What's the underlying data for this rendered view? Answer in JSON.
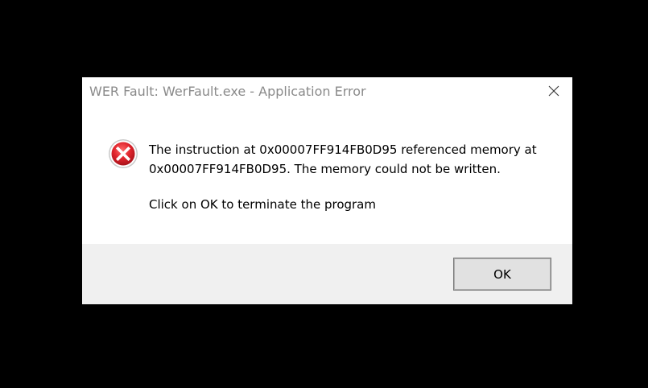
{
  "window": {
    "title": "WER Fault: WerFault.exe - Application Error"
  },
  "icons": {
    "close": "close-icon",
    "error": "error-icon"
  },
  "message": {
    "line1": "The instruction at 0x00007FF914FB0D95 referenced memory at",
    "line2": "0x00007FF914FB0D95. The memory could not be written.",
    "line3": "Click on OK to terminate the program"
  },
  "buttons": {
    "ok_label": "OK"
  },
  "colors": {
    "error_red": "#e81123",
    "title_gray": "#8a8a8a",
    "footer_bg": "#f0f0f0"
  }
}
